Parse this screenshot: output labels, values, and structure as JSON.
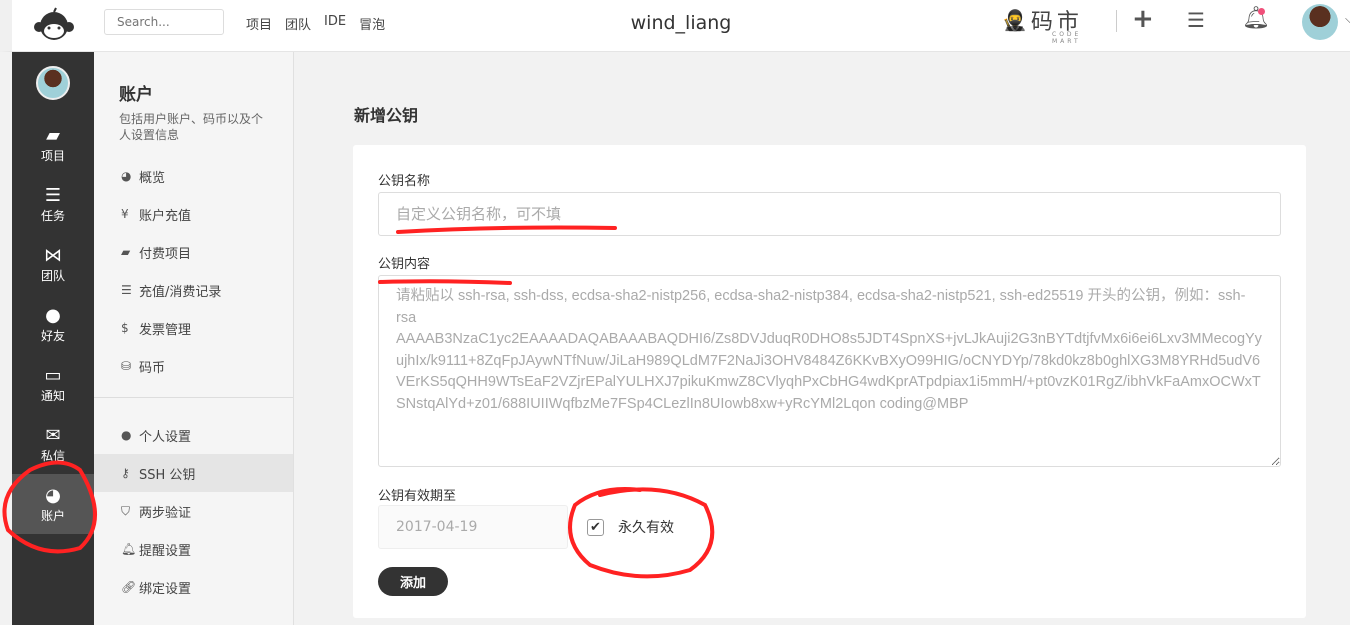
{
  "topbar": {
    "search_placeholder": "Search...",
    "nav": [
      "项目",
      "团队",
      "IDE",
      "冒泡"
    ],
    "title": "wind_liang",
    "brand": "码市",
    "brand_sub": "CODE MART",
    "notification_color": "#f0507a"
  },
  "sidebar": {
    "items": [
      {
        "label": "项目",
        "icon": "folder-icon"
      },
      {
        "label": "任务",
        "icon": "tasks-icon"
      },
      {
        "label": "团队",
        "icon": "team-icon"
      },
      {
        "label": "好友",
        "icon": "user-icon"
      },
      {
        "label": "通知",
        "icon": "inbox-icon"
      },
      {
        "label": "私信",
        "icon": "mail-icon"
      },
      {
        "label": "账户",
        "icon": "dashboard-icon",
        "active": true
      }
    ]
  },
  "subpanel": {
    "title": "账户",
    "desc": "包括用户账户、码币以及个人设置信息",
    "group1": [
      {
        "label": "概览",
        "icon": "dashboard-icon"
      },
      {
        "label": "账户充值",
        "icon": "yen-icon"
      },
      {
        "label": "付费项目",
        "icon": "folder-icon"
      },
      {
        "label": "充值/消费记录",
        "icon": "list-icon"
      },
      {
        "label": "发票管理",
        "icon": "dollar-icon"
      },
      {
        "label": "码币",
        "icon": "coins-icon"
      }
    ],
    "group2": [
      {
        "label": "个人设置",
        "icon": "user-icon"
      },
      {
        "label": "SSH 公钥",
        "icon": "key-icon",
        "active": true
      },
      {
        "label": "两步验证",
        "icon": "shield-icon"
      },
      {
        "label": "提醒设置",
        "icon": "bell-icon"
      },
      {
        "label": "绑定设置",
        "icon": "link-icon"
      }
    ]
  },
  "main": {
    "title": "新增公钥",
    "name_label": "公钥名称",
    "name_placeholder": "自定义公钥名称，可不填",
    "content_label": "公钥内容",
    "content_placeholder": "请粘贴以 ssh-rsa, ssh-dss, ecdsa-sha2-nistp256, ecdsa-sha2-nistp384, ecdsa-sha2-nistp521, ssh-ed25519 开头的公钥，例如：ssh-rsa AAAAB3NzaC1yc2EAAAADAQABAAABAQDHI6/Zs8DVJduqR0DHO8s5JDT4SpnXS+jvLJkAuji2G3nBYTdtjfvMx6i6ei6Lxv3MMecogYyujhIx/k9111+8ZqFpJAywNTfNuw/JiLaH989QLdM7F2NaJi3OHV8484Z6KKvBXyO99HIG/oCNYDYp/78kd0kz8b0ghlXG3M8YRHd5udV6VErKS5qQHH9WTsEaF2VZjrEPalYULHXJ7pikuKmwZ8CVlyqhPxCbHG4wdKprATpdpiax1i5mmH/+pt0vzK01RgZ/ibhVkFaAmxOCWxTSNstqAlYd+z01/688IUIIWqfbzMe7FSp4CLezlIn8UIowb8xw+yRcYMl2Lqon coding@MBP",
    "expiry_label": "公钥有效期至",
    "expiry_value": "2017-04-19",
    "permanent_label": "永久有效",
    "permanent_checked": true,
    "add_button": "添加"
  }
}
